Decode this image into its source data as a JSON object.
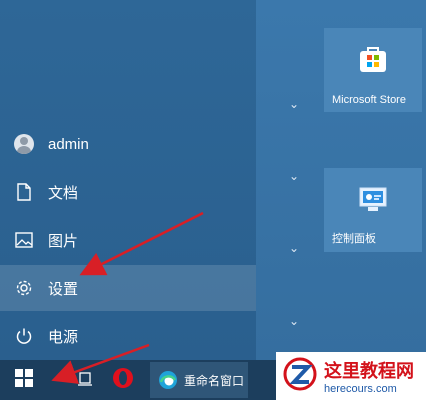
{
  "start_menu": {
    "user": {
      "label": "admin"
    },
    "items": [
      {
        "label": "文档"
      },
      {
        "label": "图片"
      },
      {
        "label": "设置"
      },
      {
        "label": "电源"
      }
    ]
  },
  "tiles": [
    {
      "label": "Microsoft Store"
    },
    {
      "label": "控制面板"
    }
  ],
  "taskbar": {
    "explorer_window_label": "重命名窗口"
  },
  "watermark": {
    "title": "这里教程网",
    "url": "herecours.com"
  },
  "annotation_color": "#d81f26"
}
